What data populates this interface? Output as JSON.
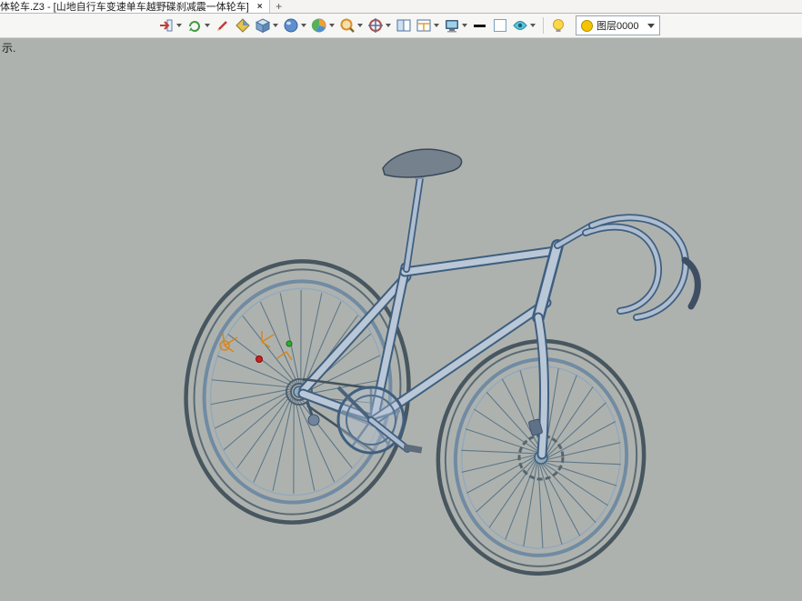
{
  "window": {
    "tab_title": "体轮车.Z3 - [山地自行车变速单车越野碟刹减震一体轮车]",
    "close_glyph": "×",
    "new_tab_glyph": "+"
  },
  "toolbar": {
    "layer_value": "图层0000",
    "icon_names": [
      "import-icon",
      "view-orientation-icon",
      "annotate-pen-icon",
      "datum-diamond-icon",
      "solid-cube-icon",
      "shaded-sphere-icon",
      "section-pie-icon",
      "zoom-icon",
      "rotate-target-icon",
      "window-pane-icon",
      "window-layout-icon",
      "display-monitor-icon",
      "line-width-icon",
      "background-color-icon",
      "view-eye-icon",
      "show-hide-bulb-icon"
    ]
  },
  "canvas": {
    "hint": "示.",
    "model_name": "山地自行车变速单车越野碟刹减震一体轮车"
  },
  "colors": {
    "canvas_bg": "#aeb2ae",
    "model_fill": "#b9c7d7",
    "model_outline": "#3f5f7f",
    "layer_swatch": "#f5c400"
  }
}
